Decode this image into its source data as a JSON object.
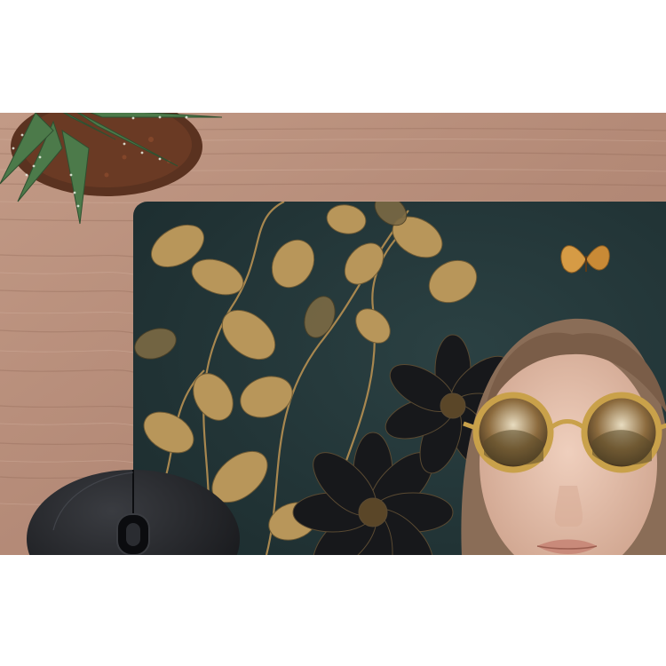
{
  "scene": {
    "colors": {
      "page_background": "#ffffff",
      "wood": "#b98f7c",
      "wood_grain_dark": "#8e6757",
      "wood_grain_light": "#d2ad9b",
      "mousepad_background": "#24383a",
      "gold_leaf": "#b8965a",
      "gold_leaf_dark": "#6e5a35",
      "dark_flower": "#17181b",
      "skin": "#e6c0ab",
      "hair": "#8a6d57",
      "sunglasses_frame": "#c9a14a",
      "butterfly": "#d69b45",
      "succulent_green": "#4c7a4a",
      "soil": "#6a3a24",
      "mouse": "#1c1d20"
    },
    "objects": [
      "wooden-desk",
      "succulent-plant",
      "mousepad",
      "computer-mouse"
    ],
    "mousepad_print": [
      "gold-leaf-vines",
      "dark-flowers",
      "butterfly",
      "woman-portrait",
      "round-gold-sunglasses"
    ]
  }
}
